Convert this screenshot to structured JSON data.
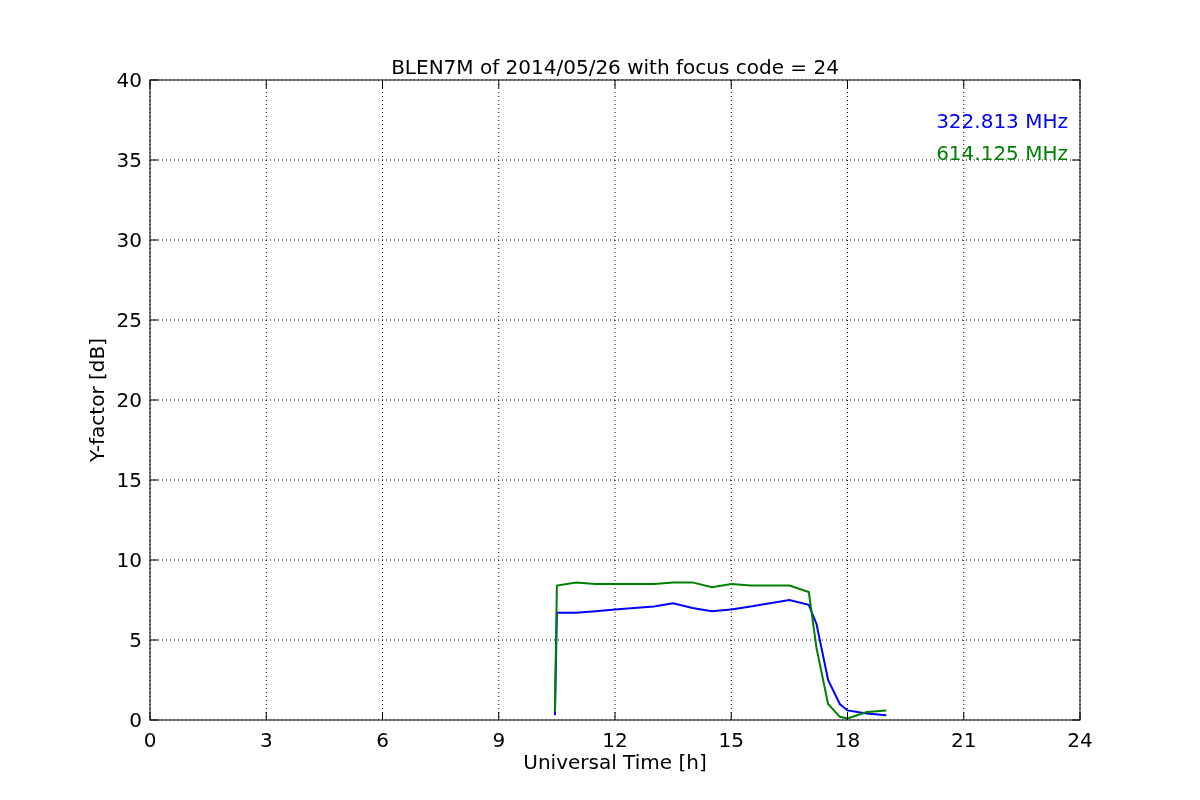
{
  "chart_data": {
    "type": "line",
    "title": "BLEN7M of 2014/05/26 with focus code = 24",
    "xlabel": "Universal Time [h]",
    "ylabel": "Y-factor [dB]",
    "x": [
      10.45,
      10.5,
      11,
      11.5,
      12,
      12.5,
      13,
      13.5,
      14,
      14.5,
      15,
      15.5,
      16,
      16.5,
      17,
      17.2,
      17.5,
      17.8,
      18,
      18.5,
      19
    ],
    "series": [
      {
        "name": "322.813 MHz",
        "color": "#0000ff",
        "values": [
          0.3,
          6.7,
          6.7,
          6.8,
          6.9,
          7.0,
          7.1,
          7.3,
          7.0,
          6.8,
          6.9,
          7.1,
          7.3,
          7.5,
          7.2,
          6.0,
          2.5,
          1.0,
          0.6,
          0.4,
          0.3
        ]
      },
      {
        "name": "614.125 MHz",
        "color": "#008000",
        "values": [
          0.5,
          8.4,
          8.6,
          8.5,
          8.5,
          8.5,
          8.5,
          8.6,
          8.6,
          8.3,
          8.5,
          8.4,
          8.4,
          8.4,
          8.0,
          4.5,
          1.0,
          0.2,
          0.1,
          0.5,
          0.6
        ]
      }
    ],
    "xlim": [
      0,
      24
    ],
    "ylim": [
      0,
      40
    ],
    "xticks": [
      0,
      3,
      6,
      9,
      12,
      15,
      18,
      21,
      24
    ],
    "yticks": [
      0,
      5,
      10,
      15,
      20,
      25,
      30,
      35,
      40
    ],
    "grid": true
  }
}
